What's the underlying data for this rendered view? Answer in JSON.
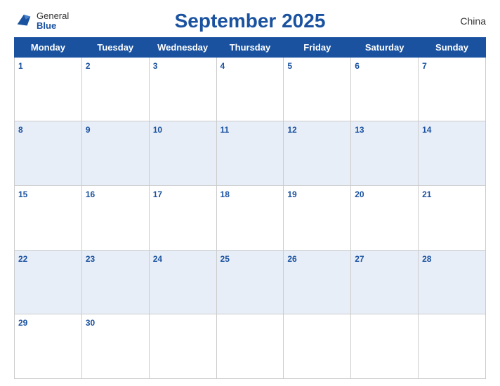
{
  "header": {
    "logo_general": "General",
    "logo_blue": "Blue",
    "title": "September 2025",
    "country": "China"
  },
  "weekdays": [
    "Monday",
    "Tuesday",
    "Wednesday",
    "Thursday",
    "Friday",
    "Saturday",
    "Sunday"
  ],
  "weeks": [
    [
      {
        "day": "1",
        "empty": false
      },
      {
        "day": "2",
        "empty": false
      },
      {
        "day": "3",
        "empty": false
      },
      {
        "day": "4",
        "empty": false
      },
      {
        "day": "5",
        "empty": false
      },
      {
        "day": "6",
        "empty": false
      },
      {
        "day": "7",
        "empty": false
      }
    ],
    [
      {
        "day": "8",
        "empty": false
      },
      {
        "day": "9",
        "empty": false
      },
      {
        "day": "10",
        "empty": false
      },
      {
        "day": "11",
        "empty": false
      },
      {
        "day": "12",
        "empty": false
      },
      {
        "day": "13",
        "empty": false
      },
      {
        "day": "14",
        "empty": false
      }
    ],
    [
      {
        "day": "15",
        "empty": false
      },
      {
        "day": "16",
        "empty": false
      },
      {
        "day": "17",
        "empty": false
      },
      {
        "day": "18",
        "empty": false
      },
      {
        "day": "19",
        "empty": false
      },
      {
        "day": "20",
        "empty": false
      },
      {
        "day": "21",
        "empty": false
      }
    ],
    [
      {
        "day": "22",
        "empty": false
      },
      {
        "day": "23",
        "empty": false
      },
      {
        "day": "24",
        "empty": false
      },
      {
        "day": "25",
        "empty": false
      },
      {
        "day": "26",
        "empty": false
      },
      {
        "day": "27",
        "empty": false
      },
      {
        "day": "28",
        "empty": false
      }
    ],
    [
      {
        "day": "29",
        "empty": false
      },
      {
        "day": "30",
        "empty": false
      },
      {
        "day": "",
        "empty": true
      },
      {
        "day": "",
        "empty": true
      },
      {
        "day": "",
        "empty": true
      },
      {
        "day": "",
        "empty": true
      },
      {
        "day": "",
        "empty": true
      }
    ]
  ]
}
